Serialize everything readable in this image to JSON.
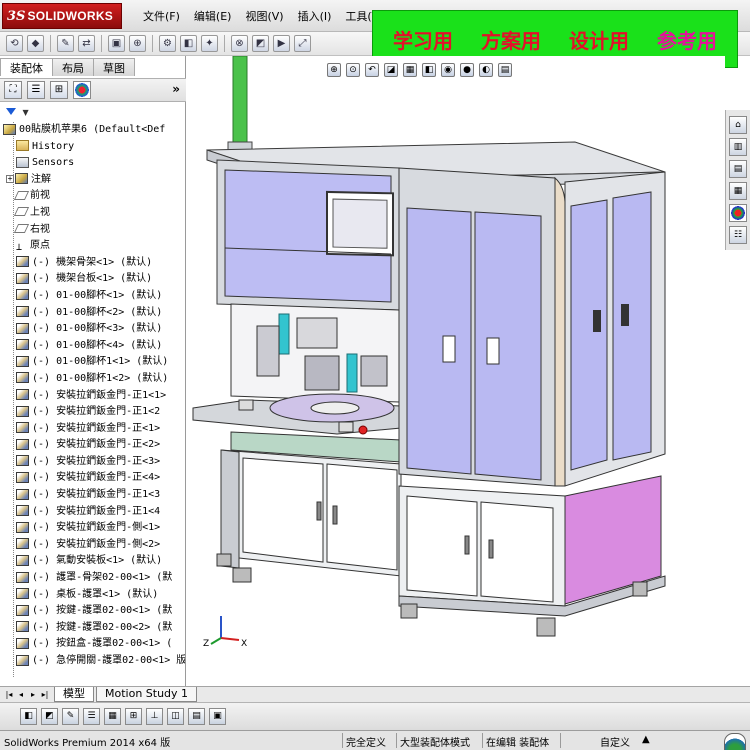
{
  "app": {
    "logo_ds": "3S",
    "logo_name": "SOLIDWORKS"
  },
  "menus": [
    "文件(F)",
    "编辑(E)",
    "视图(V)",
    "插入(I)",
    "工具(T)"
  ],
  "banner": {
    "items": [
      {
        "text": "学习用",
        "color": "#e3102a"
      },
      {
        "text": "方案用",
        "color": "#e3102a"
      },
      {
        "text": "设计用",
        "color": "#e3102a"
      },
      {
        "text": "参考用",
        "color": "#e4129a"
      }
    ]
  },
  "left_panel": {
    "tabs": [
      "装配体",
      "布局",
      "草图"
    ],
    "expand_glyph": "»"
  },
  "tree": {
    "root": "00貼膜机苹果6  (Default<Def",
    "items": [
      {
        "icon": "folder",
        "label": "History"
      },
      {
        "icon": "sensor",
        "label": "Sensors"
      },
      {
        "icon": "annotation",
        "label": "注解",
        "expandable": true
      },
      {
        "icon": "plane",
        "label": "前视"
      },
      {
        "icon": "plane",
        "label": "上视"
      },
      {
        "icon": "plane",
        "label": "右视"
      },
      {
        "icon": "origin",
        "label": "原点"
      },
      {
        "icon": "asm",
        "label": "(-) 機架骨架<1> (默认)"
      },
      {
        "icon": "asm",
        "label": "(-) 機架台板<1> (默认)"
      },
      {
        "icon": "asm",
        "label": "(-) 01-00腳杯<1> (默认)"
      },
      {
        "icon": "asm",
        "label": "(-) 01-00腳杯<2> (默认)"
      },
      {
        "icon": "asm",
        "label": "(-) 01-00腳杯<3> (默认)"
      },
      {
        "icon": "asm",
        "label": "(-) 01-00腳杯<4> (默认)"
      },
      {
        "icon": "asm",
        "label": "(-) 01-00腳杯1<1> (默认)"
      },
      {
        "icon": "asm",
        "label": "(-) 01-00腳杯1<2> (默认)"
      },
      {
        "icon": "asm",
        "label": "(-) 安裝拉鍆鈑金門-正1<1>"
      },
      {
        "icon": "asm",
        "label": "(-) 安裝拉鍆鈑金門-正1<2"
      },
      {
        "icon": "asm",
        "label": "(-) 安裝拉鍆鈑金門-正<1>"
      },
      {
        "icon": "asm",
        "label": "(-) 安裝拉鍆鈑金門-正<2>"
      },
      {
        "icon": "asm",
        "label": "(-) 安裝拉鍆鈑金門-正<3>"
      },
      {
        "icon": "asm",
        "label": "(-) 安裝拉鍆鈑金門-正<4>"
      },
      {
        "icon": "asm",
        "label": "(-) 安裝拉鍆鈑金門-正1<3"
      },
      {
        "icon": "asm",
        "label": "(-) 安裝拉鍆鈑金門-正1<4"
      },
      {
        "icon": "asm",
        "label": "(-) 安裝拉鍆鈑金門-側<1>"
      },
      {
        "icon": "asm",
        "label": "(-) 安裝拉鍆鈑金門-側<2>"
      },
      {
        "icon": "asm",
        "label": "(-) 氣動安裝板<1> (默认)"
      },
      {
        "icon": "asm",
        "label": "(-) 護罩-骨架02-00<1> (默"
      },
      {
        "icon": "asm",
        "label": "(-) 桌板-護罩<1> (默认)"
      },
      {
        "icon": "asm",
        "label": "(-) 按鍵-護罩02-00<1> (默"
      },
      {
        "icon": "asm",
        "label": "(-) 按鍵-護罩02-00<2> (默"
      },
      {
        "icon": "asm",
        "label": "(-) 按鈕盒-護罩02-00<1> ("
      },
      {
        "icon": "asm",
        "label": "(-) 急停開關-護罩02-00<1> 版"
      }
    ]
  },
  "viewport": {
    "triad_z": "Z",
    "triad_x": "X"
  },
  "bottom_tabs": [
    "模型",
    "Motion Study 1"
  ],
  "status_bar": {
    "app_version": "SolidWorks Premium 2014 x64 版",
    "full_defined": "完全定义",
    "large_asm": "大型装配体模式",
    "editing": "在编辑 装配体",
    "custom": "自定义"
  },
  "colors": {
    "banner_bg": "#1ae11a",
    "door_panel": "#b9b9f2",
    "side_panel": "#d98be0",
    "frame": "#d7dadf",
    "column": "#4ac24a"
  }
}
